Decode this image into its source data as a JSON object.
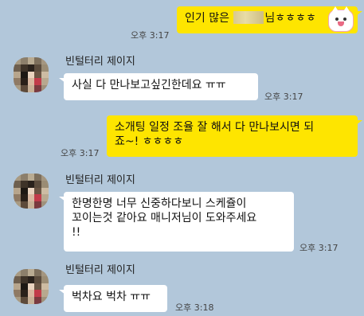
{
  "chat": {
    "contact_name": "빈털터리 제이지",
    "messages": [
      {
        "side": "me",
        "text_before": "인기 많은 ",
        "text_after": "님ㅎㅎㅎㅎ",
        "time": "오후 3:17"
      },
      {
        "side": "them",
        "lines": [
          "사실 다 만나보고싶긴한데요 ㅠㅠ"
        ],
        "time": "오후 3:17"
      },
      {
        "side": "me",
        "lines": [
          "소개팅 일정 조율 잘 해서 다 만나보시면 되",
          "죠~! ㅎㅎㅎㅎ"
        ],
        "time": "오후 3:17"
      },
      {
        "side": "them",
        "lines": [
          "한명한명 너무 신중하다보니 스케쥴이",
          "꼬이는것 같아요 매니저님이 도와주세요",
          "!!"
        ],
        "time": "오후 3:17"
      },
      {
        "side": "them",
        "lines": [
          "벅차요 벅차 ㅠㅠ"
        ],
        "time": "오후 3:18"
      }
    ]
  },
  "colors": {
    "background": "#b2c7da",
    "my_bubble": "#fee500",
    "their_bubble": "#ffffff"
  },
  "icons": {
    "sticker": "pink-cat-emoji-icon",
    "avatar": "pixelated-profile-avatar"
  }
}
